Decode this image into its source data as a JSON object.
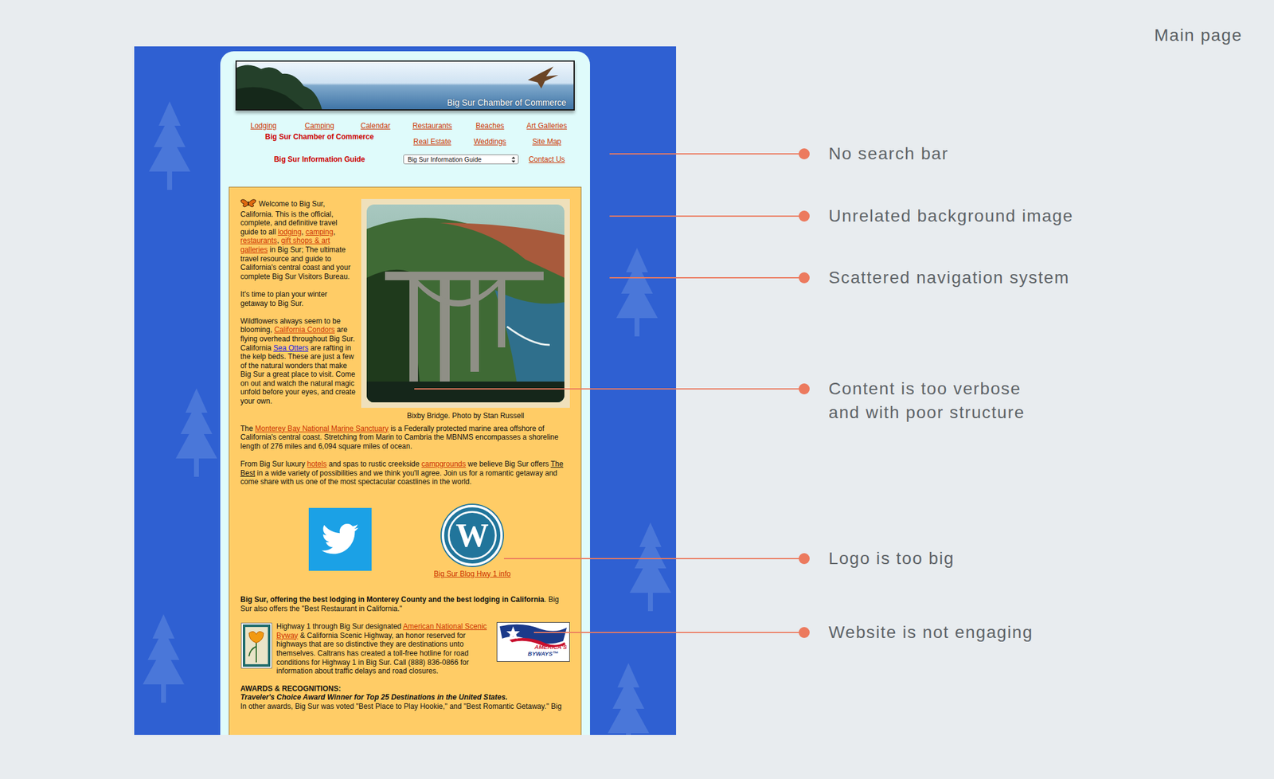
{
  "page": {
    "label": "Main page"
  },
  "site": {
    "banner": {
      "title": "Big Sur Chamber of Commerce"
    },
    "nav": {
      "links": [
        {
          "label": "Lodging"
        },
        {
          "label": "Camping"
        },
        {
          "label": "Calendar"
        },
        {
          "label": "Restaurants"
        },
        {
          "label": "Beaches"
        },
        {
          "label": "Art Galleries"
        }
      ],
      "chamber_label": "Big Sur Chamber of Commerce",
      "links_row2": [
        {
          "label": "Real Estate"
        },
        {
          "label": "Weddings"
        },
        {
          "label": "Site Map"
        }
      ],
      "guide_label": "Big Sur Information Guide",
      "guide_select": {
        "value": "Big Sur Information Guide"
      },
      "contact": "Contact Us"
    },
    "intro": [
      {
        "segments": [
          {
            "text": "Welcome to Big Sur, California. This is the official, complete, and definitive travel guide to all ",
            "kind": "text"
          },
          {
            "text": "lodging",
            "kind": "link"
          },
          {
            "text": ", ",
            "kind": "text"
          },
          {
            "text": "camping",
            "kind": "link"
          },
          {
            "text": ", ",
            "kind": "text"
          },
          {
            "text": "restaurants",
            "kind": "link"
          },
          {
            "text": ", ",
            "kind": "text"
          },
          {
            "text": "gift shops & art galleries",
            "kind": "link"
          },
          {
            "text": " in Big Sur; The ultimate travel resource and guide to California's central coast and your complete Big Sur Visitors Bureau.",
            "kind": "text"
          }
        ]
      },
      {
        "segments": [
          {
            "text": "It's time to plan your winter getaway to Big Sur.",
            "kind": "text"
          }
        ]
      },
      {
        "segments": [
          {
            "text": "Wildflowers always seem to be blooming, ",
            "kind": "text"
          },
          {
            "text": "California Condors",
            "kind": "link"
          },
          {
            "text": " are flying overhead throughout Big Sur. California ",
            "kind": "text"
          },
          {
            "text": "Sea Otters",
            "kind": "link-blue"
          },
          {
            "text": " are rafting in the kelp beds. These are just a few of the natural wonders that make Big Sur a great place to visit. Come on out and watch the natural magic unfold before your eyes, and create your own.",
            "kind": "text"
          }
        ]
      }
    ],
    "photo": {
      "caption": "Bixby Bridge. Photo by Stan Russell"
    },
    "paragraphs": [
      {
        "segments": [
          {
            "text": "The ",
            "kind": "text"
          },
          {
            "text": "Monterey Bay National Marine Sanctuary",
            "kind": "link"
          },
          {
            "text": " is a Federally protected marine area offshore of California's central coast. Stretching from Marin to Cambria the MBNMS encompasses a shoreline length of 276 miles and 6,094 square miles of ocean.",
            "kind": "text"
          }
        ]
      },
      {
        "segments": [
          {
            "text": "From Big Sur luxury ",
            "kind": "text"
          },
          {
            "text": "hotels",
            "kind": "link"
          },
          {
            "text": " and spas to rustic creekside ",
            "kind": "text"
          },
          {
            "text": "campgrounds",
            "kind": "link"
          },
          {
            "text": " we believe Big Sur offers ",
            "kind": "text"
          },
          {
            "text": "The Best",
            "kind": "underline"
          },
          {
            "text": " in a wide variety of possibilities and we think you'll agree. Join us for a romantic getaway and come share with us one of the most spectacular coastlines in the world.",
            "kind": "text"
          }
        ]
      }
    ],
    "social": {
      "wordpress_mark": "W",
      "blog_link": "Big Sur Blog Hwy 1 info"
    },
    "tagline": {
      "segments": [
        {
          "text": "Big Sur, offering the best lodging in Monterey County and the best lodging in California",
          "kind": "bold"
        },
        {
          "text": ". Big Sur also offers the \"Best Restaurant in California.\"",
          "kind": "text"
        }
      ]
    },
    "byway": {
      "segments": [
        {
          "text": "Highway 1 through Big Sur designated ",
          "kind": "text"
        },
        {
          "text": "American National Scenic Byway",
          "kind": "link"
        },
        {
          "text": " & California Scenic Highway, an honor reserved for highways that are so distinctive they are destinations unto themselves. Caltrans has created a toll-free hotline for road conditions for Highway 1 in Big Sur. Call (888) 836-0866 for information about traffic delays and road closures.",
          "kind": "text"
        }
      ],
      "logo_line1": "AMERICA'S",
      "logo_line2": "BYWAYS™"
    },
    "awards": {
      "heading": "AWARDS & RECOGNITIONS:",
      "highlight": "Traveler's Choice Award Winner for Top 25 Destinations in the United States.",
      "text": "In other awards, Big Sur was voted \"Best Place to Play Hookie,\" and \"Best Romantic Getaway.\" Big"
    }
  },
  "annotations": [
    {
      "lines": [
        "No search bar"
      ]
    },
    {
      "lines": [
        "Unrelated background image"
      ]
    },
    {
      "lines": [
        "Scattered navigation system"
      ]
    },
    {
      "lines": [
        "Content is too verbose",
        "and with poor structure"
      ]
    },
    {
      "lines": [
        "Logo is too big"
      ]
    },
    {
      "lines": [
        "Website is not engaging"
      ]
    }
  ]
}
